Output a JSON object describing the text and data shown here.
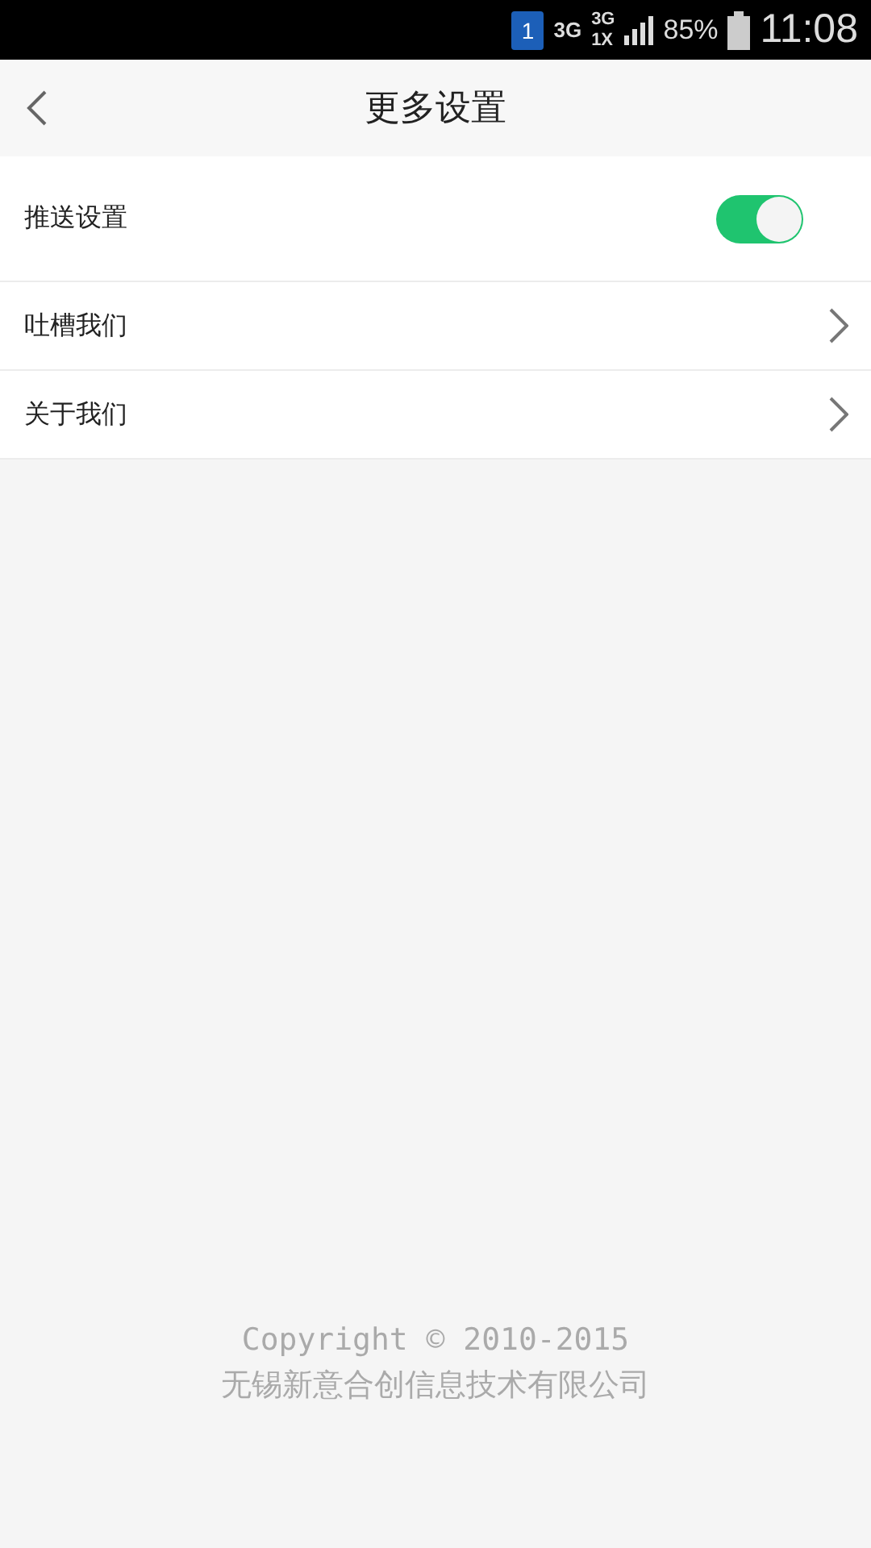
{
  "status_bar": {
    "sim": "1",
    "network_1": "3G",
    "network_2_top": "3G",
    "network_2_bottom": "1X",
    "battery": "85%",
    "time": "11:08"
  },
  "header": {
    "title": "更多设置"
  },
  "settings": [
    {
      "kind": "toggle",
      "label": "推送设置",
      "on": true
    },
    {
      "kind": "link",
      "label": "吐槽我们"
    },
    {
      "kind": "link",
      "label": "关于我们"
    }
  ],
  "footer": {
    "copyright": "Copyright © 2010-2015",
    "company": "无锡新意合创信息技术有限公司"
  }
}
